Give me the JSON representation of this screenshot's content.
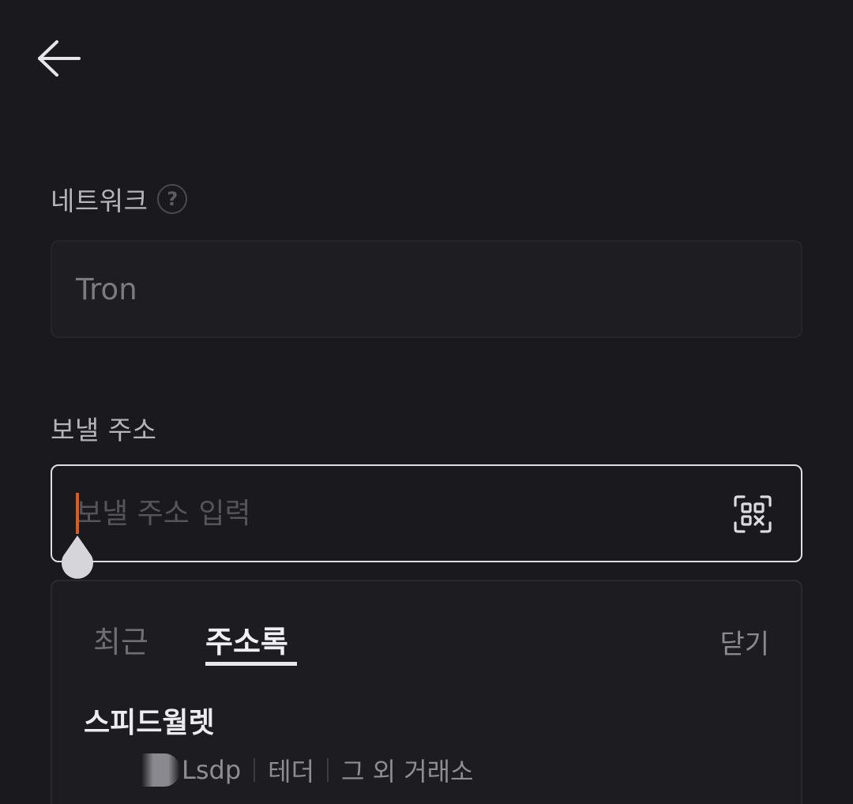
{
  "network": {
    "label": "네트워크",
    "help_symbol": "?",
    "value": "Tron"
  },
  "address": {
    "label": "보낼 주소",
    "placeholder": "보낼 주소 입력",
    "value": ""
  },
  "dropdown": {
    "tabs": [
      {
        "label": "최근",
        "active": false
      },
      {
        "label": "주소록",
        "active": true
      }
    ],
    "close_label": "닫기",
    "entries": [
      {
        "name": "스피드월렛",
        "address_tail": "Lsdp",
        "tags": [
          "테더",
          "그 외 거래소"
        ]
      }
    ]
  },
  "colors": {
    "background": "#1a191e",
    "caret": "#e05a1c",
    "focus_border": "#dedde2"
  }
}
